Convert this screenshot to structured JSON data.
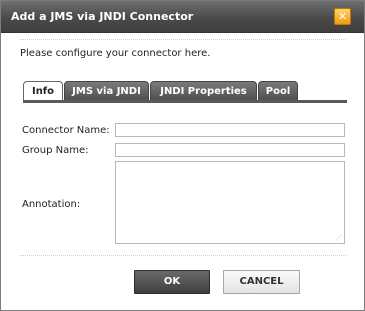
{
  "dialog": {
    "title": "Add a JMS via JNDI Connector",
    "close_glyph": "✕",
    "intro": "Please configure your connector here."
  },
  "tabs": [
    {
      "label": "Info",
      "active": true
    },
    {
      "label": "JMS via JNDI",
      "active": false
    },
    {
      "label": "JNDI Properties",
      "active": false
    },
    {
      "label": "Pool",
      "active": false
    }
  ],
  "form": {
    "connector_name_label": "Connector Name:",
    "connector_name_value": "",
    "group_name_label": "Group Name:",
    "group_name_value": "",
    "annotation_label": "Annotation:",
    "annotation_value": ""
  },
  "buttons": {
    "ok": "OK",
    "cancel": "CANCEL"
  }
}
